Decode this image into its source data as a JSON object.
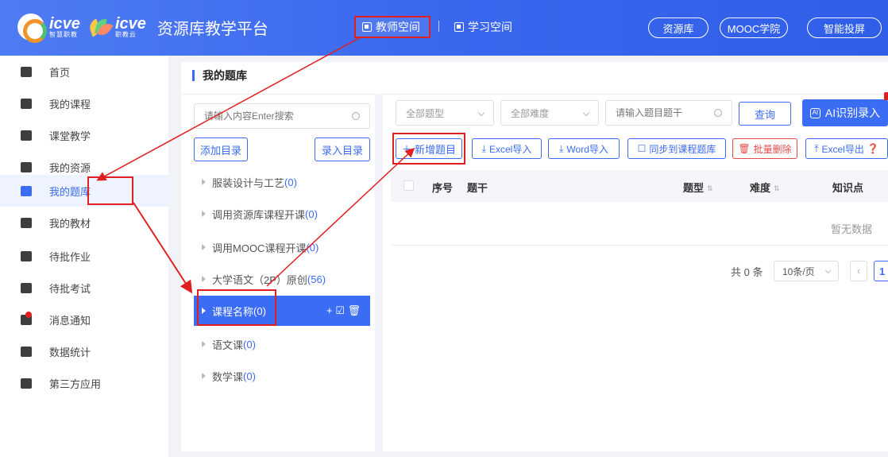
{
  "header": {
    "logo1_text": "icve",
    "logo1_sub": "智慧职教",
    "logo2_text": "icve",
    "logo2_sub": "职教云",
    "platform_title": "资源库教学平台",
    "teacher_space": "教师空间",
    "student_space": "学习空间",
    "resource_lib": "资源库",
    "mooc": "MOOC学院",
    "ai_screen": "智能投屏"
  },
  "sidebar": {
    "items": [
      {
        "label": "首页",
        "icon": "home-icon"
      },
      {
        "label": "我的课程",
        "icon": "courses-icon"
      },
      {
        "label": "课堂教学",
        "icon": "classroom-icon"
      },
      {
        "label": "我的资源",
        "icon": "resources-icon"
      },
      {
        "label": "我的题库",
        "icon": "question-bank-icon"
      },
      {
        "label": "我的教材",
        "icon": "textbook-icon"
      },
      {
        "label": "待批作业",
        "icon": "homework-icon"
      },
      {
        "label": "待批考试",
        "icon": "exam-icon"
      },
      {
        "label": "消息通知",
        "icon": "message-icon"
      },
      {
        "label": "数据统计",
        "icon": "stats-icon"
      },
      {
        "label": "第三方应用",
        "icon": "apps-icon"
      }
    ],
    "active_index": 4
  },
  "main": {
    "title": "我的题库",
    "tree": {
      "search_placeholder": "请输入内容Enter搜索",
      "add_dir": "添加目录",
      "record_dir": "录入目录",
      "items": [
        {
          "name": "服装设计与工艺",
          "count": "(0)"
        },
        {
          "name": "调用资源库课程开课",
          "count": "(0)"
        },
        {
          "name": "调用MOOC课程开课",
          "count": "(0)"
        },
        {
          "name": "大学语文（2P）原创",
          "count": "(56)"
        },
        {
          "name": "课程名称",
          "count": "(0)",
          "active": true
        },
        {
          "name": "语文课",
          "count": "(0)"
        },
        {
          "name": "数学课",
          "count": "(0)"
        }
      ],
      "active_actions": "+ ☑ 🗑"
    },
    "filters": {
      "type_placeholder": "全部题型",
      "difficulty_placeholder": "全部难度",
      "question_placeholder": "请输入题目题干",
      "query": "查询",
      "ai_record": "AI识别录入"
    },
    "toolbar": {
      "new_question": "新增题目",
      "excel_import": "Excel导入",
      "word_import": "Word导入",
      "sync_course": "同步到课程题库",
      "batch_delete": "批量删除",
      "excel_export": "Excel导出"
    },
    "table": {
      "columns": [
        "序号",
        "题干",
        "题型",
        "难度",
        "知识点"
      ],
      "rows": [],
      "empty_text": "暂无数据"
    },
    "pager": {
      "total": "共 0 条",
      "page_size": "10条/页",
      "current_page": "1"
    }
  },
  "colors": {
    "brand": "#3a6cf4",
    "annotation_red": "#e02020",
    "danger": "#e84a4a"
  }
}
